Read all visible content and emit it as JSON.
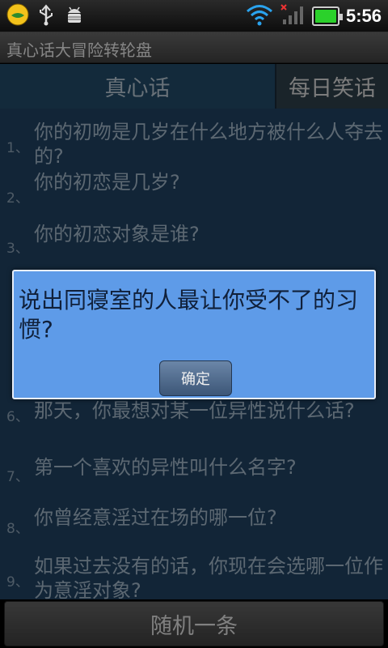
{
  "status_bar": {
    "time": "5:56",
    "icons": [
      "qq-icon",
      "usb-icon",
      "android-debug-icon",
      "wifi-icon",
      "signal-off-icon",
      "battery-icon"
    ]
  },
  "app": {
    "title": "真心话大冒险转轮盘"
  },
  "tabs": [
    {
      "label": "真心话",
      "active": true
    },
    {
      "label": "每日笑话",
      "active": false
    }
  ],
  "list": [
    {
      "num": "1、",
      "text": "你的初吻是几岁在什么地方被什么人夺去的?"
    },
    {
      "num": "2、",
      "text": "你的初恋是几岁?"
    },
    {
      "num": "3、",
      "text": "你的初恋对象是谁?"
    },
    {
      "num": "6、",
      "text": "那天，你最想对某一位异性说什么话?"
    },
    {
      "num": "7、",
      "text": "第一个喜欢的异性叫什么名字?"
    },
    {
      "num": "8、",
      "text": "你曾经意淫过在场的哪一位?"
    },
    {
      "num": "9、",
      "text": "如果过去没有的话，你现在会选哪一位作为意淫对象?"
    }
  ],
  "dialog": {
    "message": "说出同寝室的人最让你受不了的习惯?",
    "confirm_label": "确定"
  },
  "bottom": {
    "random_label": "随机一条"
  },
  "colors": {
    "accent": "#5e9be8",
    "list_bg": "#1e3c5a",
    "battery": "#2bd12b",
    "wifi": "#2aa3ee"
  }
}
